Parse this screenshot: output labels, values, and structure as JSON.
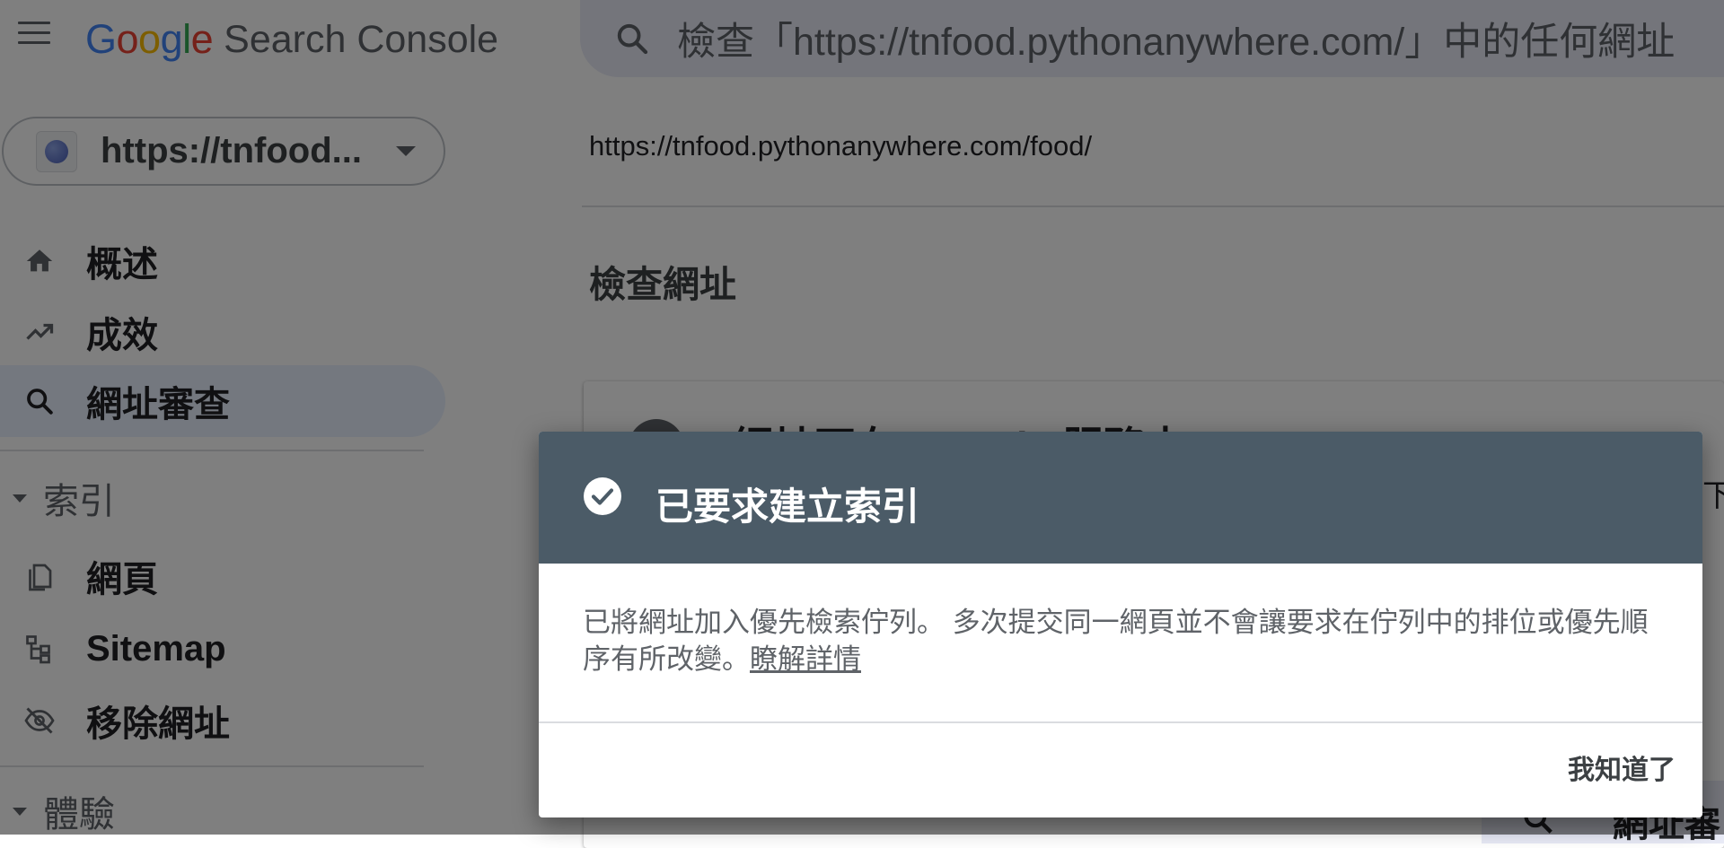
{
  "header": {
    "logo_google_letters": [
      "G",
      "o",
      "o",
      "g",
      "l",
      "e"
    ],
    "logo_colors": [
      "#4285F4",
      "#EA4335",
      "#FBBC05",
      "#4285F4",
      "#34A853",
      "#EA4335"
    ],
    "logo_product": "Search Console",
    "search_placeholder": "檢查「https://tnfood.pythonanywhere.com/」中的任何網址"
  },
  "sidebar": {
    "property": "https://tnfood...",
    "items": [
      {
        "label": "概述",
        "icon": "home-icon"
      },
      {
        "label": "成效",
        "icon": "trending-up-icon"
      },
      {
        "label": "網址審查",
        "icon": "search-icon",
        "active": true
      }
    ],
    "sections": [
      {
        "label": "索引",
        "items": [
          {
            "label": "網頁",
            "icon": "pages-icon"
          },
          {
            "label": "Sitemap",
            "icon": "sitemap-icon"
          },
          {
            "label": "移除網址",
            "icon": "eye-off-icon"
          }
        ]
      },
      {
        "label": "體驗"
      }
    ]
  },
  "main": {
    "url": "https://tnfood.pythonanywhere.com/food/",
    "title": "檢查網址",
    "card_title": "網址不在 Google 服務中",
    "card_right_text": "下",
    "card_button": "網址審"
  },
  "dialog": {
    "title": "已要求建立索引",
    "body": "已將網址加入優先檢索佇列。 多次提交同一網頁並不會讓要求在佇列中的排位或優先順序有所改變。",
    "link": "瞭解詳情",
    "ok": "我知道了"
  },
  "colors": {
    "dialog_header": "#4b5b67",
    "active_nav": "#e8f0fe",
    "search_bg": "#e8eaf6"
  }
}
